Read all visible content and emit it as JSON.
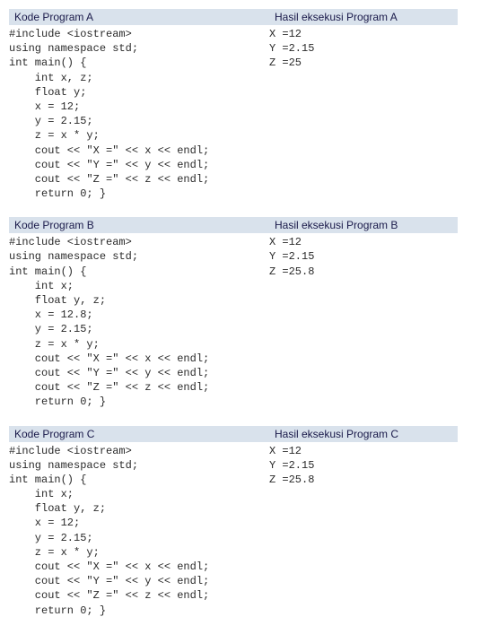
{
  "programs": [
    {
      "code_header": "Kode Program A",
      "result_header": "Hasil eksekusi Program A",
      "code": "#include <iostream>\nusing namespace std;\nint main() {\n    int x, z;\n    float y;\n    x = 12;\n    y = 2.15;\n    z = x * y;\n    cout << \"X =\" << x << endl;\n    cout << \"Y =\" << y << endl;\n    cout << \"Z =\" << z << endl;\n    return 0; }",
      "output": "X =12\nY =2.15\nZ =25"
    },
    {
      "code_header": "Kode Program B",
      "result_header": "Hasil eksekusi Program B",
      "code": "#include <iostream>\nusing namespace std;\nint main() {\n    int x;\n    float y, z;\n    x = 12.8;\n    y = 2.15;\n    z = x * y;\n    cout << \"X =\" << x << endl;\n    cout << \"Y =\" << y << endl;\n    cout << \"Z =\" << z << endl;\n    return 0; }",
      "output": "X =12\nY =2.15\nZ =25.8"
    },
    {
      "code_header": "Kode Program C",
      "result_header": "Hasil eksekusi Program C",
      "code": "#include <iostream>\nusing namespace std;\nint main() {\n    int x;\n    float y, z;\n    x = 12;\n    y = 2.15;\n    z = x * y;\n    cout << \"X =\" << x << endl;\n    cout << \"Y =\" << y << endl;\n    cout << \"Z =\" << z << endl;\n    return 0; }",
      "output": "X =12\nY =2.15\nZ =25.8"
    }
  ]
}
